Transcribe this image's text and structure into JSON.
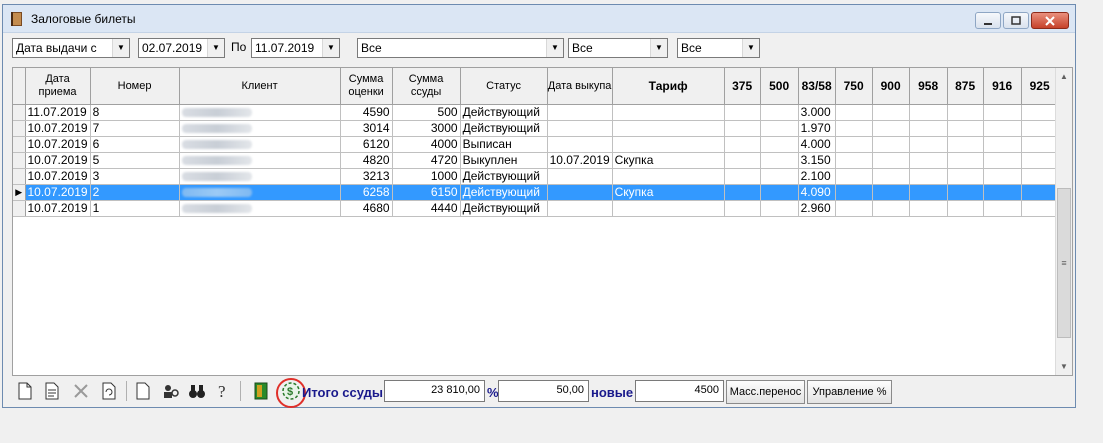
{
  "window": {
    "title": "Залоговые билеты"
  },
  "filters": {
    "date_mode": "Дата выдачи с",
    "date_from": "02.07.2019",
    "to_label": "По",
    "date_to": "11.07.2019",
    "filter1": "Все",
    "filter2": "Все",
    "filter3": "Все"
  },
  "grid": {
    "columns": [
      "Дата приема",
      "Номер",
      "Клиент",
      "Сумма оценки",
      "Сумма ссуды",
      "Статус",
      "Дата выкупа",
      "Тариф",
      "375",
      "500",
      "83/58",
      "750",
      "900",
      "958",
      "875",
      "916",
      "925"
    ],
    "rows": [
      {
        "date": "11.07.2019",
        "num": "8",
        "appraisal": "4590",
        "loan": "500",
        "status": "Действующий",
        "redeem": "",
        "tariff": "",
        "c8358": "3.000",
        "selected": false
      },
      {
        "date": "10.07.2019",
        "num": "7",
        "appraisal": "3014",
        "loan": "3000",
        "status": "Действующий",
        "redeem": "",
        "tariff": "",
        "c8358": "1.970",
        "selected": false
      },
      {
        "date": "10.07.2019",
        "num": "6",
        "appraisal": "6120",
        "loan": "4000",
        "status": "Выписан",
        "redeem": "",
        "tariff": "",
        "c8358": "4.000",
        "selected": false
      },
      {
        "date": "10.07.2019",
        "num": "5",
        "appraisal": "4820",
        "loan": "4720",
        "status": "Выкуплен",
        "redeem": "10.07.2019",
        "tariff": "Скупка",
        "c8358": "3.150",
        "selected": false
      },
      {
        "date": "10.07.2019",
        "num": "3",
        "appraisal": "3213",
        "loan": "1000",
        "status": "Действующий",
        "redeem": "",
        "tariff": "",
        "c8358": "2.100",
        "selected": false
      },
      {
        "date": "10.07.2019",
        "num": "2",
        "appraisal": "6258",
        "loan": "6150",
        "status": "Действующий",
        "redeem": "",
        "tariff": "Скупка",
        "c8358": "4.090",
        "selected": true
      },
      {
        "date": "10.07.2019",
        "num": "1",
        "appraisal": "4680",
        "loan": "4440",
        "status": "Действующий",
        "redeem": "",
        "tariff": "",
        "c8358": "2.960",
        "selected": false
      }
    ]
  },
  "bottom": {
    "total_label": "Итого ссуды",
    "total_value": "23 810,00",
    "percent_label": "%",
    "percent_value": "50,00",
    "new_label": "новые",
    "new_value": "4500",
    "mass_transfer": "Масс.перенос",
    "manage_percent": "Управление %"
  },
  "icons": [
    "new-doc-icon",
    "edit-doc-icon",
    "delete-icon",
    "refresh-icon",
    "blank-doc-icon",
    "user-search-icon",
    "binoculars-icon",
    "help-icon",
    "exit-door-icon",
    "money-circle-icon"
  ]
}
